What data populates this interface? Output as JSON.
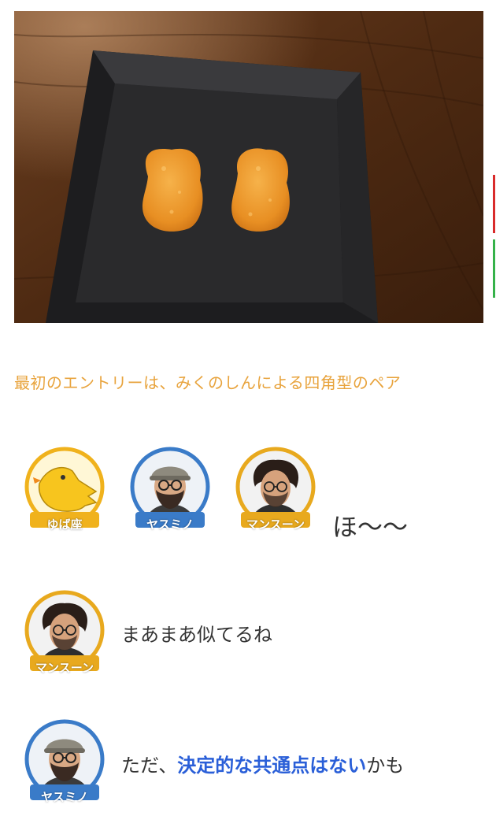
{
  "photo": {
    "alt_icon": "nuggets-plate-photo"
  },
  "caption": "最初のエントリーは、みくのしんによる四角型のペア",
  "chat": [
    {
      "avatars": [
        {
          "name": "ゆば座",
          "icon": "bird-avatar-icon",
          "ring": "#f0b21c"
        },
        {
          "name": "ヤスミノ",
          "icon": "person-cap-avatar-icon",
          "ring": "#3a7bc8"
        },
        {
          "name": "マンスーン",
          "icon": "person-curly-avatar-icon",
          "ring": "#e8a91e"
        }
      ],
      "text": "ほ〜〜"
    },
    {
      "avatars": [
        {
          "name": "マンスーン",
          "icon": "person-curly-avatar-icon",
          "ring": "#e8a91e"
        }
      ],
      "text": "まあまあ似てるね"
    },
    {
      "avatars": [
        {
          "name": "ヤスミノ",
          "icon": "person-cap-avatar-icon",
          "ring": "#3a7bc8"
        }
      ],
      "text_before": "ただ、",
      "text_highlight": "決定的な共通点はない",
      "text_after": "かも",
      "highlight_color": "#2a5fd8"
    }
  ],
  "colors": {
    "caption": "#e8a33c",
    "text": "#333333"
  }
}
